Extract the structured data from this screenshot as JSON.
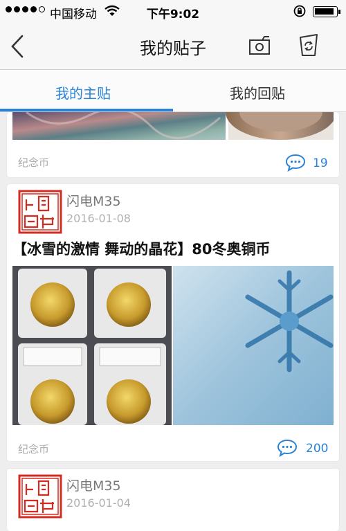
{
  "status_bar": {
    "carrier": "中国移动",
    "time": "下午9:02"
  },
  "nav": {
    "title": "我的贴子",
    "back_icon": "chevron-left-icon",
    "camera_icon": "camera-icon",
    "trash_icon": "trash-refresh-icon"
  },
  "tabs": [
    {
      "label": "我的主贴",
      "active": true
    },
    {
      "label": "我的回贴",
      "active": false
    }
  ],
  "posts": [
    {
      "tag": "纪念币",
      "comments": "19"
    },
    {
      "author": "闪电M35",
      "date": "2016-01-08",
      "title": "【冰雪的激情  舞动的晶花】80冬奥铜币",
      "tag": "纪念币",
      "comments": "200"
    },
    {
      "author": "闪电M35",
      "date": "2016-01-04"
    }
  ],
  "colors": {
    "accent": "#2a82d6",
    "seal_red": "#d42b20"
  }
}
